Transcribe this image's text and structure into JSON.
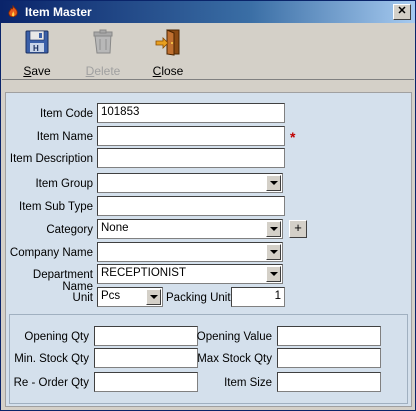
{
  "window": {
    "title": "Item Master",
    "close_glyph": "✕"
  },
  "toolbar": {
    "save": {
      "label_key": "S",
      "label_rest": "ave",
      "icon": "floppy-disk-icon"
    },
    "delete": {
      "label_key": "D",
      "label_rest": "elete",
      "icon": "trash-bin-icon",
      "enabled": false
    },
    "close": {
      "label_key": "C",
      "label_rest": "lose",
      "icon": "exit-door-icon"
    }
  },
  "form": {
    "item_code": {
      "label": "Item Code",
      "value": "101853"
    },
    "item_name": {
      "label": "Item Name",
      "value": "",
      "required_mark": "*"
    },
    "item_description": {
      "label": "Item Description",
      "value": ""
    },
    "item_group": {
      "label": "Item Group",
      "value": ""
    },
    "item_sub_type": {
      "label": "Item Sub Type",
      "value": ""
    },
    "category": {
      "label": "Category",
      "value": "None",
      "add_glyph": "+"
    },
    "company_name": {
      "label": "Company Name",
      "value": ""
    },
    "department_name": {
      "label": "Department Name",
      "value": "RECEPTIONIST"
    },
    "unit": {
      "label": "Unit",
      "value": "Pcs"
    },
    "packing_unit": {
      "label": "Packing Unit",
      "value": "1"
    }
  },
  "stock": {
    "opening_qty": {
      "label": "Opening Qty",
      "value": ""
    },
    "opening_value": {
      "label": "Opening Value",
      "value": ""
    },
    "min_stock_qty": {
      "label": "Min. Stock Qty",
      "value": ""
    },
    "max_stock_qty": {
      "label": "Max Stock Qty",
      "value": ""
    },
    "reorder_qty": {
      "label": "Re - Order Qty",
      "value": ""
    },
    "item_size": {
      "label": "Item Size",
      "value": ""
    }
  },
  "colors": {
    "title_bar": "#0a246a",
    "panel_bg": "#d4e0ec",
    "required": "#c00000"
  }
}
